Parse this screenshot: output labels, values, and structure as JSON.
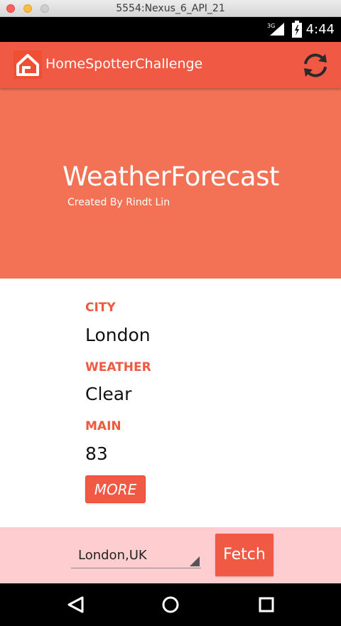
{
  "window": {
    "title": "5554:Nexus_6_API_21"
  },
  "status_bar": {
    "time": "4:44",
    "network": "3G"
  },
  "app_bar": {
    "title": "HomeSpotterChallenge",
    "logo_icon": "house-logo-icon",
    "refresh_icon": "refresh-icon"
  },
  "hero": {
    "title": "WeatherForecast",
    "subtitle": "Created By Rindt Lin"
  },
  "fields": {
    "city": {
      "label": "CITY",
      "value": "London"
    },
    "weather": {
      "label": "WEATHER",
      "value": "Clear"
    },
    "main": {
      "label": "MAIN",
      "value": "83"
    }
  },
  "more_button": {
    "label": "MORE"
  },
  "fetch_bar": {
    "selected_city": "London,UK",
    "fetch_label": "Fetch"
  },
  "colors": {
    "accent": "#f05a44",
    "hero": "#f37256",
    "fetch_bar": "#fecdd0",
    "label": "#ee5a40"
  }
}
